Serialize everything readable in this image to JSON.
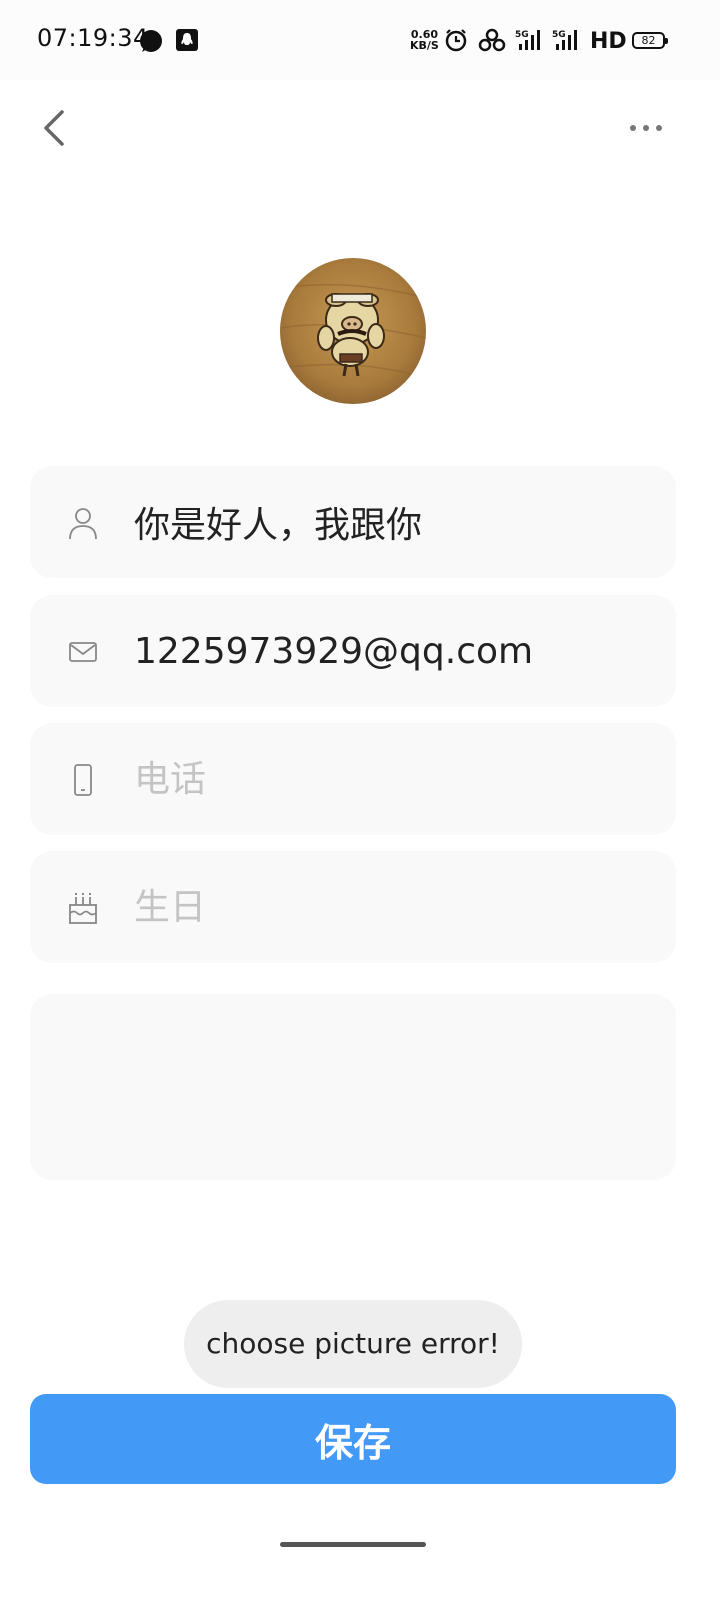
{
  "status_bar": {
    "time": "07:19:34",
    "net_speed_value": "0.60",
    "net_speed_unit": "KB/S",
    "hd_label": "HD",
    "battery": "82",
    "signal_label": "5G"
  },
  "nav": {
    "back_icon": "chevron-left-icon",
    "more_icon": "more-horizontal-icon"
  },
  "profile": {
    "name": "你是好人，我跟你",
    "email": "1225973929@qq.com",
    "phone_value": "",
    "phone_placeholder": "电话",
    "birthday_value": "",
    "birthday_placeholder": "生日",
    "notes": ""
  },
  "toast": {
    "message": "choose picture error!"
  },
  "actions": {
    "save_label": "保存"
  },
  "colors": {
    "primary": "#4399f6",
    "field_bg": "#f9f9f9",
    "placeholder": "#c4c4c4",
    "toast_bg": "#eeeeee"
  }
}
